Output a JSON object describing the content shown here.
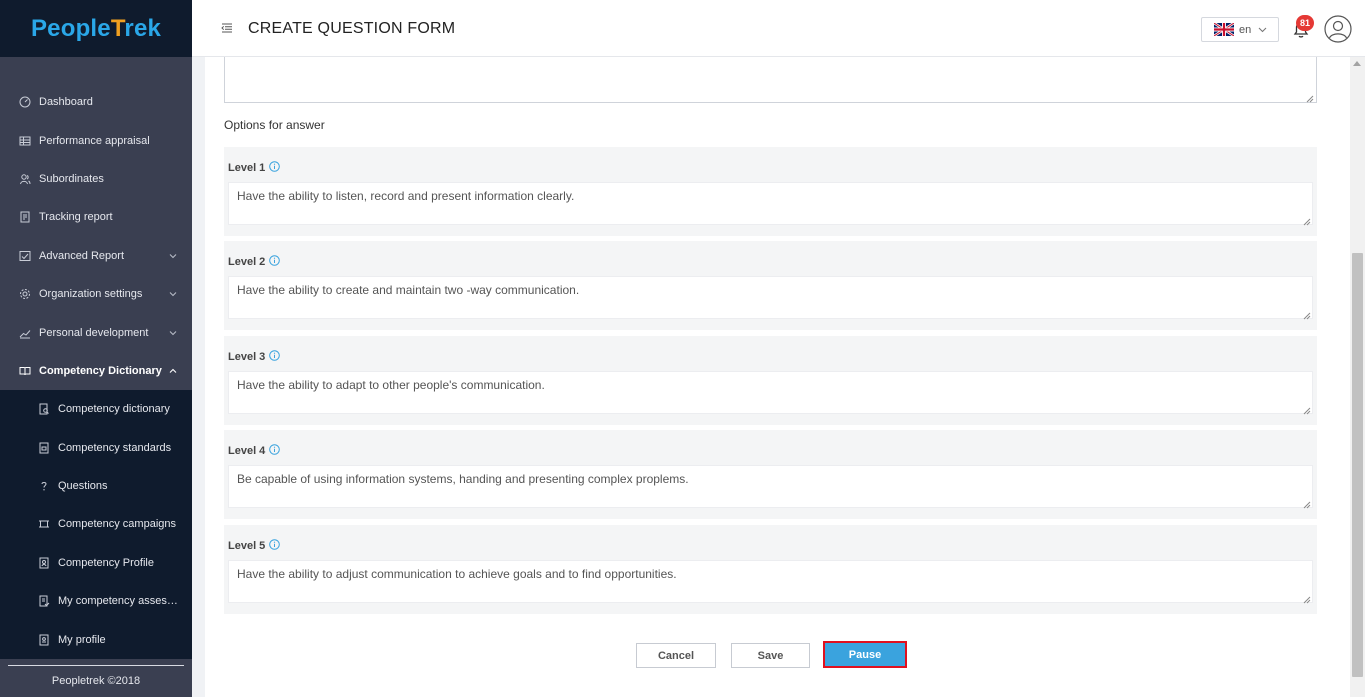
{
  "app": {
    "logo_main": "People",
    "logo_tail": "rek",
    "logo_cross": "T"
  },
  "sidebar": {
    "items": [
      {
        "label": "Dashboard",
        "icon": "dashboard-icon"
      },
      {
        "label": "Performance appraisal",
        "icon": "table-icon"
      },
      {
        "label": "Subordinates",
        "icon": "people-icon"
      },
      {
        "label": "Tracking report",
        "icon": "report-icon"
      },
      {
        "label": "Advanced Report",
        "icon": "chart-check-icon",
        "chevron": "down"
      },
      {
        "label": "Organization settings",
        "icon": "gear-icon",
        "chevron": "down"
      },
      {
        "label": "Personal development",
        "icon": "trend-icon",
        "chevron": "down"
      },
      {
        "label": "Competency Dictionary",
        "icon": "book-icon",
        "chevron": "up",
        "active": true
      }
    ],
    "subitems": [
      {
        "label": "Competency dictionary",
        "icon": "doc-search-icon"
      },
      {
        "label": "Competency standards",
        "icon": "doc-icon"
      },
      {
        "label": "Questions",
        "icon": "question-icon"
      },
      {
        "label": "Competency campaigns",
        "icon": "campaign-icon"
      },
      {
        "label": "Competency Profile",
        "icon": "profile-doc-icon"
      },
      {
        "label": "My competency assessment",
        "icon": "assessment-icon"
      },
      {
        "label": "My profile",
        "icon": "my-profile-icon"
      }
    ],
    "footer": "Peopletrek ©2018"
  },
  "header": {
    "title": "CREATE QUESTION FORM",
    "language_code": "en",
    "notification_count": "81"
  },
  "form": {
    "options_title": "Options for answer",
    "levels": [
      {
        "label": "Level 1",
        "value": "Have the ability to listen, record and present information clearly."
      },
      {
        "label": "Level 2",
        "value": "Have the ability to create and maintain two -way communication."
      },
      {
        "label": "Level 3",
        "value": "Have the ability to adapt to other people's communication."
      },
      {
        "label": "Level 4",
        "value": "Be capable of using information systems, handing and presenting complex proplems."
      },
      {
        "label": "Level 5",
        "value": "Have the ability to adjust communication to achieve goals and to find opportunities."
      }
    ],
    "buttons": {
      "cancel": "Cancel",
      "save": "Save",
      "pause": "Pause"
    }
  },
  "colors": {
    "sidebar_bg": "#3a3f51",
    "sidebar_dark": "#0f1b2d",
    "accent": "#3aa3de",
    "highlight_border": "#e0101e",
    "badge": "#e53935"
  }
}
